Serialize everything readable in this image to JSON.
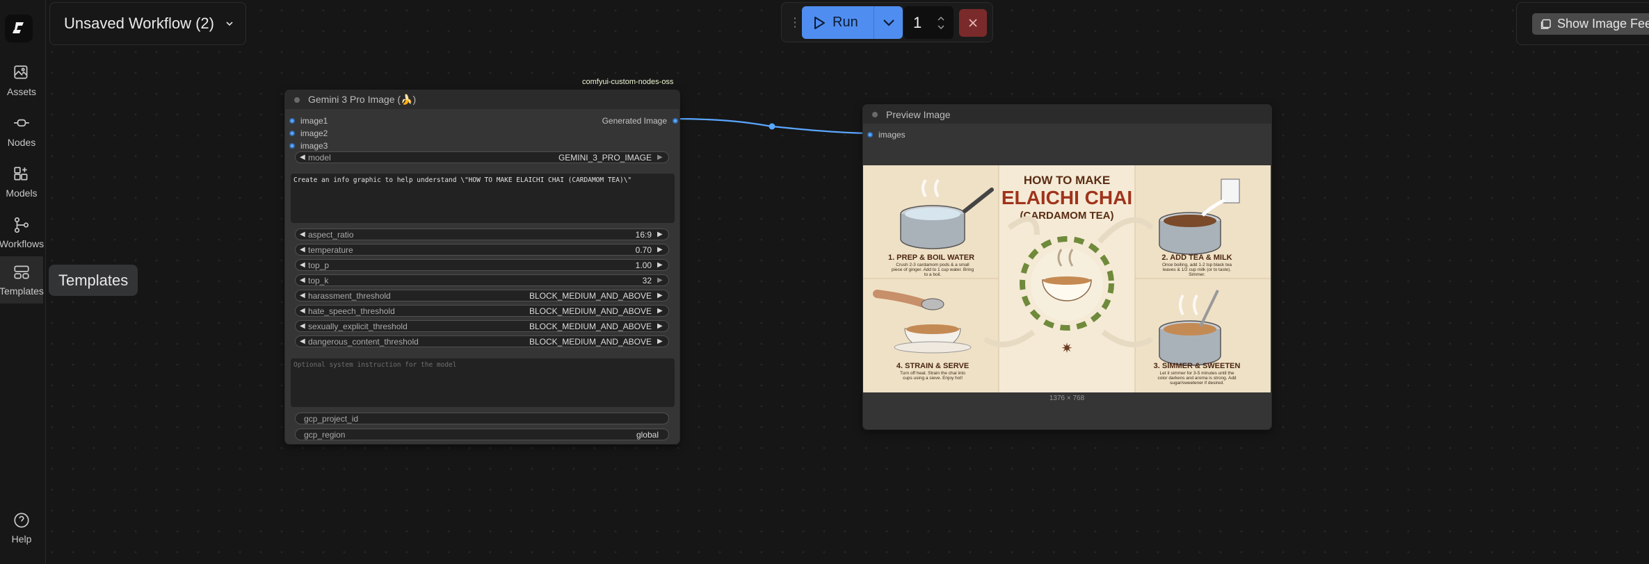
{
  "sidebar": {
    "items": [
      {
        "label": "Assets",
        "icon": "image-stack-icon"
      },
      {
        "label": "Nodes",
        "icon": "node-link-icon"
      },
      {
        "label": "Models",
        "icon": "cubes-sparkle-icon"
      },
      {
        "label": "Workflows",
        "icon": "workflow-tree-icon"
      },
      {
        "label": "Templates",
        "icon": "template-layout-icon"
      }
    ],
    "help_label": "Help",
    "tooltip": "Templates"
  },
  "header": {
    "workflow_title": "Unsaved Workflow (2)",
    "run_label": "Run",
    "queue_count": "1",
    "feed_label": "Show Image Feed"
  },
  "gemini_node": {
    "badge": "comfyui-custom-nodes-oss",
    "title": "Gemini 3 Pro Image (🍌)",
    "inputs": [
      "image1",
      "image2",
      "image3"
    ],
    "output": "Generated Image",
    "model": {
      "label": "model",
      "value": "GEMINI_3_PRO_IMAGE"
    },
    "prompt": "Create an info graphic to help understand \\\"HOW TO MAKE ELAICHI CHAI (CARDAMOM TEA)\\\"",
    "params": [
      {
        "label": "aspect_ratio",
        "value": "16:9"
      },
      {
        "label": "temperature",
        "value": "0.70"
      },
      {
        "label": "top_p",
        "value": "1.00"
      },
      {
        "label": "top_k",
        "value": "32"
      },
      {
        "label": "harassment_threshold",
        "value": "BLOCK_MEDIUM_AND_ABOVE"
      },
      {
        "label": "hate_speech_threshold",
        "value": "BLOCK_MEDIUM_AND_ABOVE"
      },
      {
        "label": "sexually_explicit_threshold",
        "value": "BLOCK_MEDIUM_AND_ABOVE"
      },
      {
        "label": "dangerous_content_threshold",
        "value": "BLOCK_MEDIUM_AND_ABOVE"
      }
    ],
    "system_placeholder": "Optional system instruction for the model",
    "gcp_project_label": "gcp_project_id",
    "gcp_region": {
      "label": "gcp_region",
      "value": "global"
    }
  },
  "preview_node": {
    "title": "Preview Image",
    "input": "images",
    "dimensions": "1376 × 768",
    "infographic": {
      "title_top": "HOW TO MAKE",
      "title_main": "ELAICHI CHAI",
      "title_sub": "(CARDAMOM TEA)",
      "steps": [
        {
          "heading": "1. PREP & BOIL WATER",
          "text": "Crush 2-3 cardamom pods & a small piece of ginger. Add to 1 cup water. Bring to a boil."
        },
        {
          "heading": "2. ADD TEA & MILK",
          "text": "Once boiling, add 1-2 tsp black tea leaves & 1/2 cup milk (or to taste). Simmer."
        },
        {
          "heading": "3. SIMMER & SWEETEN",
          "text": "Let it simmer for 3-5 minutes until the color darkens and aroma is strong. Add sugar/sweetener if desired."
        },
        {
          "heading": "4. STRAIN & SERVE",
          "text": "Turn off heat. Strain the chai into cups using a sieve. Enjoy hot!"
        }
      ]
    }
  },
  "colors": {
    "accent": "#4f8ef0",
    "link": "#5aa7ff",
    "stop": "#7a2a2a",
    "canvas": "#161616"
  }
}
